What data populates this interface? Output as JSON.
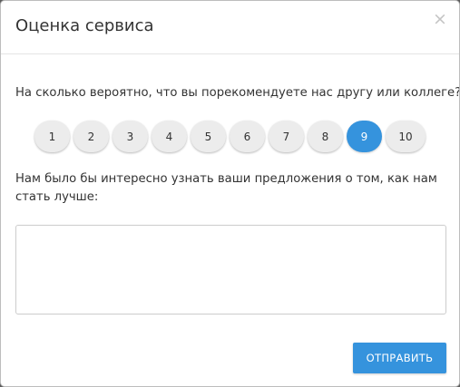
{
  "dialog": {
    "title": "Оценка сервиса",
    "close_glyph": "×",
    "question": "На сколько вероятно, что вы порекомендуете нас другу или коллеге?",
    "scores": [
      "1",
      "2",
      "3",
      "4",
      "5",
      "6",
      "7",
      "8",
      "9",
      "10"
    ],
    "selected_score": "9",
    "suggestion_label": "Нам было бы интересно узнать ваши предложения о том, как нам стать лучше:",
    "feedback_value": "",
    "submit_label": "ОТПРАВИТЬ"
  },
  "colors": {
    "accent": "#3593dd",
    "score_bg": "#ececec",
    "text": "#333333"
  },
  "icons": {
    "close": "close-icon"
  }
}
